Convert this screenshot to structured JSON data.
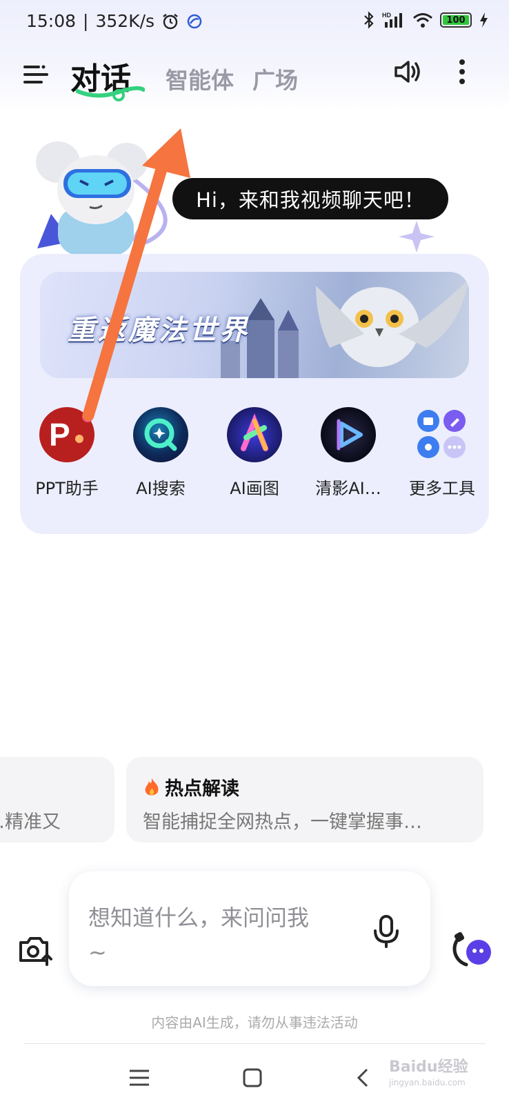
{
  "status_bar": {
    "time": "15:08",
    "network_speed": "352K/s",
    "battery_level": "100",
    "icons": [
      "alarm-icon",
      "app-status-icon",
      "bluetooth-icon",
      "signal-icon",
      "wifi-icon",
      "battery-icon",
      "charging-icon"
    ]
  },
  "header": {
    "tabs": [
      {
        "label": "对话",
        "active": true
      },
      {
        "label": "智能体",
        "active": false
      },
      {
        "label": "广场",
        "active": false
      }
    ],
    "icons": [
      "menu-icon",
      "speaker-icon",
      "more-vertical-icon"
    ]
  },
  "hero": {
    "bubble_text": "Hi，来和我视频聊天吧！"
  },
  "banner": {
    "title": "重返魔法世界"
  },
  "tools": [
    {
      "label": "PPT助手",
      "icon": "ppt-icon"
    },
    {
      "label": "AI搜索",
      "icon": "ai-search-icon"
    },
    {
      "label": "AI画图",
      "icon": "ai-draw-icon"
    },
    {
      "label": "清影AI…",
      "icon": "video-play-icon"
    },
    {
      "label": "更多工具",
      "icon": "more-tools-icon"
    }
  ],
  "suggestions": [
    {
      "title": "",
      "desc": "精准又…"
    },
    {
      "title": "热点解读",
      "icon": "fire-icon",
      "desc": "智能捕捉全网热点，一键掌握事…"
    }
  ],
  "input": {
    "placeholder_line1": "想知道什么，来问问我",
    "placeholder_line2": "~"
  },
  "disclaimer": "内容由AI生成，请勿从事违法活动",
  "nav": [
    "menu-nav-icon",
    "home-nav-icon",
    "back-nav-icon"
  ],
  "watermark": {
    "brand": "Baidu经验",
    "url": "jingyan.baidu.com"
  },
  "colors": {
    "accent_green": "#34d17e",
    "annotation_arrow": "#f5743f",
    "card_bg": "#eceefd"
  }
}
